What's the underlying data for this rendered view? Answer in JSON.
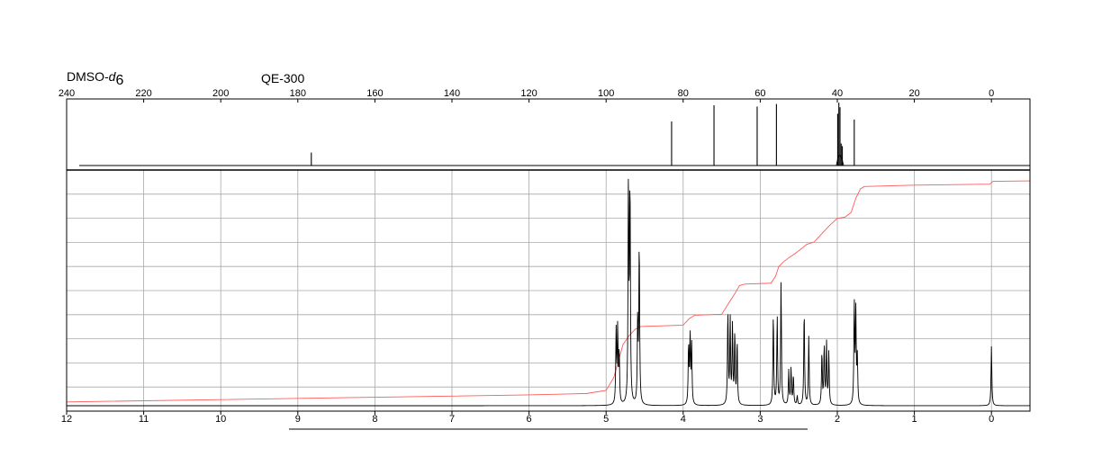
{
  "header": {
    "solvent_prefix": "DMSO-",
    "solvent_italic": "d",
    "solvent_subscript": "6",
    "instrument": "QE-300"
  },
  "colors": {
    "frame": "#000000",
    "grid": "#a8a8a8",
    "spectrum": "#000000",
    "integral": "#ff5a5a"
  },
  "chart_data": [
    {
      "type": "line",
      "name": "13C NMR spectrum",
      "xlim": [
        240,
        -10
      ],
      "x_reversed": true,
      "ticks": [
        240,
        220,
        200,
        180,
        160,
        140,
        120,
        100,
        80,
        60,
        40,
        20,
        0
      ],
      "ylim": [
        0,
        100
      ],
      "peaks": [
        {
          "x": 176.5,
          "y": 20
        },
        {
          "x": 83.0,
          "y": 68
        },
        {
          "x": 72.0,
          "y": 93
        },
        {
          "x": 60.8,
          "y": 91
        },
        {
          "x": 55.8,
          "y": 95
        },
        {
          "x": 39.9,
          "y": 80
        },
        {
          "x": 39.6,
          "y": 97
        },
        {
          "x": 39.3,
          "y": 90
        },
        {
          "x": 39.0,
          "y": 34
        },
        {
          "x": 38.7,
          "y": 30
        },
        {
          "x": 35.6,
          "y": 71
        }
      ]
    },
    {
      "type": "line",
      "name": "1H NMR spectrum",
      "xlim": [
        12,
        -0.5
      ],
      "x_reversed": true,
      "ticks": [
        12,
        11,
        10,
        9,
        8,
        7,
        6,
        5,
        4,
        3,
        2,
        1,
        0
      ],
      "ylim": [
        0,
        100
      ],
      "vertical_grid": [
        11,
        10,
        9,
        8,
        7,
        6,
        5,
        4,
        3,
        2,
        1,
        0
      ],
      "horizontal_grid_lines": 9,
      "peaks": [
        {
          "x": 4.87,
          "y": 32
        },
        {
          "x": 4.85,
          "y": 33
        },
        {
          "x": 4.83,
          "y": 22
        },
        {
          "x": 4.71,
          "y": 98
        },
        {
          "x": 4.69,
          "y": 96
        },
        {
          "x": 4.59,
          "y": 37
        },
        {
          "x": 4.57,
          "y": 71
        },
        {
          "x": 3.93,
          "y": 26
        },
        {
          "x": 3.91,
          "y": 30
        },
        {
          "x": 3.89,
          "y": 26
        },
        {
          "x": 3.42,
          "y": 41
        },
        {
          "x": 3.39,
          "y": 37
        },
        {
          "x": 3.36,
          "y": 34
        },
        {
          "x": 3.33,
          "y": 31
        },
        {
          "x": 3.3,
          "y": 28
        },
        {
          "x": 2.83,
          "y": 40
        },
        {
          "x": 2.78,
          "y": 39
        },
        {
          "x": 2.73,
          "y": 54
        },
        {
          "x": 2.63,
          "y": 15
        },
        {
          "x": 2.6,
          "y": 16
        },
        {
          "x": 2.57,
          "y": 13
        },
        {
          "x": 2.52,
          "y": 4
        },
        {
          "x": 2.43,
          "y": 42
        },
        {
          "x": 2.37,
          "y": 30
        },
        {
          "x": 2.2,
          "y": 23
        },
        {
          "x": 2.17,
          "y": 26
        },
        {
          "x": 2.14,
          "y": 27
        },
        {
          "x": 2.11,
          "y": 23
        },
        {
          "x": 1.78,
          "y": 44
        },
        {
          "x": 1.76,
          "y": 40
        },
        {
          "x": 1.74,
          "y": 20
        },
        {
          "x": 0.0,
          "y": 26
        }
      ],
      "integral_curve": [
        [
          12.0,
          1.6
        ],
        [
          10.0,
          2.6
        ],
        [
          8.0,
          3.6
        ],
        [
          6.0,
          4.6
        ],
        [
          5.25,
          5.2
        ],
        [
          5.0,
          6.5
        ],
        [
          4.9,
          12.0
        ],
        [
          4.78,
          26.0
        ],
        [
          4.7,
          29.8
        ],
        [
          4.62,
          32.5
        ],
        [
          4.55,
          33.6
        ],
        [
          4.0,
          34.2
        ],
        [
          3.92,
          37.0
        ],
        [
          3.85,
          38.4
        ],
        [
          3.5,
          38.8
        ],
        [
          3.4,
          44.0
        ],
        [
          3.33,
          47.5
        ],
        [
          3.27,
          51.0
        ],
        [
          3.2,
          51.6
        ],
        [
          2.86,
          52.0
        ],
        [
          2.8,
          55.0
        ],
        [
          2.76,
          59.0
        ],
        [
          2.7,
          61.0
        ],
        [
          2.62,
          63.0
        ],
        [
          2.55,
          64.5
        ],
        [
          2.45,
          67.0
        ],
        [
          2.4,
          68.4
        ],
        [
          2.3,
          69.5
        ],
        [
          2.2,
          73.0
        ],
        [
          2.1,
          76.5
        ],
        [
          2.0,
          79.5
        ],
        [
          1.9,
          80.0
        ],
        [
          1.82,
          82.0
        ],
        [
          1.76,
          88.0
        ],
        [
          1.7,
          92.0
        ],
        [
          1.65,
          93.0
        ],
        [
          1.0,
          93.6
        ],
        [
          0.02,
          94.0
        ],
        [
          -0.02,
          95.2
        ],
        [
          -0.5,
          95.4
        ]
      ]
    }
  ]
}
